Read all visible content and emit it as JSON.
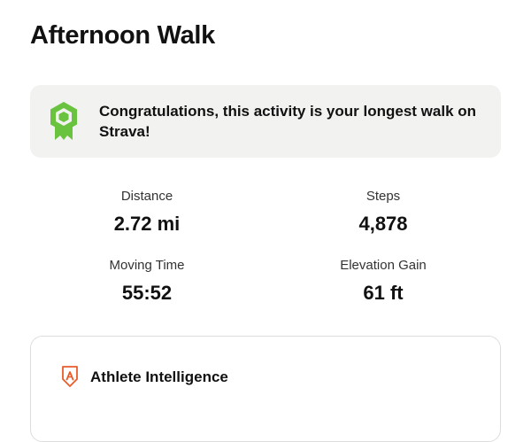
{
  "activity": {
    "title": "Afternoon Walk"
  },
  "achievement": {
    "icon": "award-ribbon-icon",
    "icon_color": "#6ac33f",
    "message": "Congratulations, this activity is your longest walk on Strava!"
  },
  "stats": [
    {
      "label": "Distance",
      "value": "2.72 mi"
    },
    {
      "label": "Steps",
      "value": "4,878"
    },
    {
      "label": "Moving Time",
      "value": "55:52"
    },
    {
      "label": "Elevation Gain",
      "value": "61 ft"
    }
  ],
  "athlete_intelligence": {
    "icon": "athlete-intelligence-icon",
    "icon_color": "#e85c2c",
    "title": "Athlete Intelligence"
  }
}
